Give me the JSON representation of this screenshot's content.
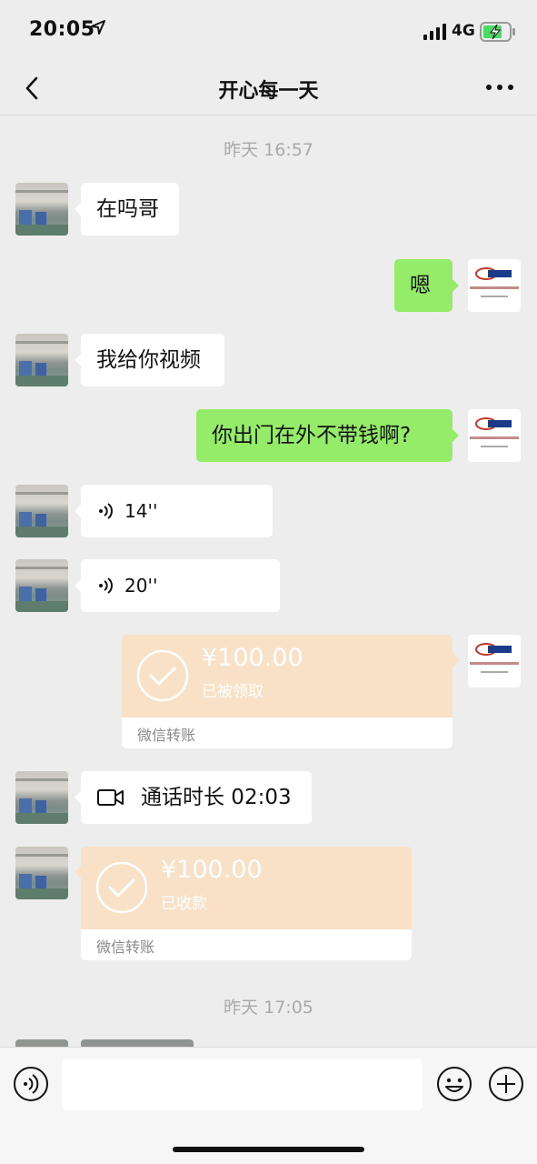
{
  "status_bar": {
    "time": "20:05",
    "network": "4G"
  },
  "nav": {
    "title": "开心每一天"
  },
  "timestamps": [
    "昨天 16:57",
    "昨天 17:05"
  ],
  "messages": [
    {
      "side": "left",
      "type": "text",
      "text": "在吗哥"
    },
    {
      "side": "right",
      "type": "text",
      "text": "嗯"
    },
    {
      "side": "left",
      "type": "text",
      "text": "我给你视频"
    },
    {
      "side": "right",
      "type": "text",
      "text": "你出门在外不带钱啊?"
    },
    {
      "side": "left",
      "type": "voice",
      "duration": "14''"
    },
    {
      "side": "left",
      "type": "voice",
      "duration": "20''"
    },
    {
      "side": "right",
      "type": "transfer",
      "amount": "¥100.00",
      "status": "已被领取",
      "label": "微信转账"
    },
    {
      "side": "left",
      "type": "call",
      "text": "通话时长 02:03"
    },
    {
      "side": "left",
      "type": "transfer",
      "amount": "¥100.00",
      "status": "已收款",
      "label": "微信转账"
    }
  ],
  "icons": {
    "back": "chevron-left-icon",
    "more": "more-dots-icon",
    "voice": "voice-wave-icon",
    "video": "video-camera-icon",
    "check": "check-circle-icon",
    "voice_input": "voice-input-icon",
    "emoji": "emoji-icon",
    "plus": "plus-circle-icon"
  },
  "colors": {
    "background": "#ededed",
    "sent_bubble": "#95ec69",
    "received_bubble": "#ffffff",
    "transfer": "#f8e1c6"
  }
}
